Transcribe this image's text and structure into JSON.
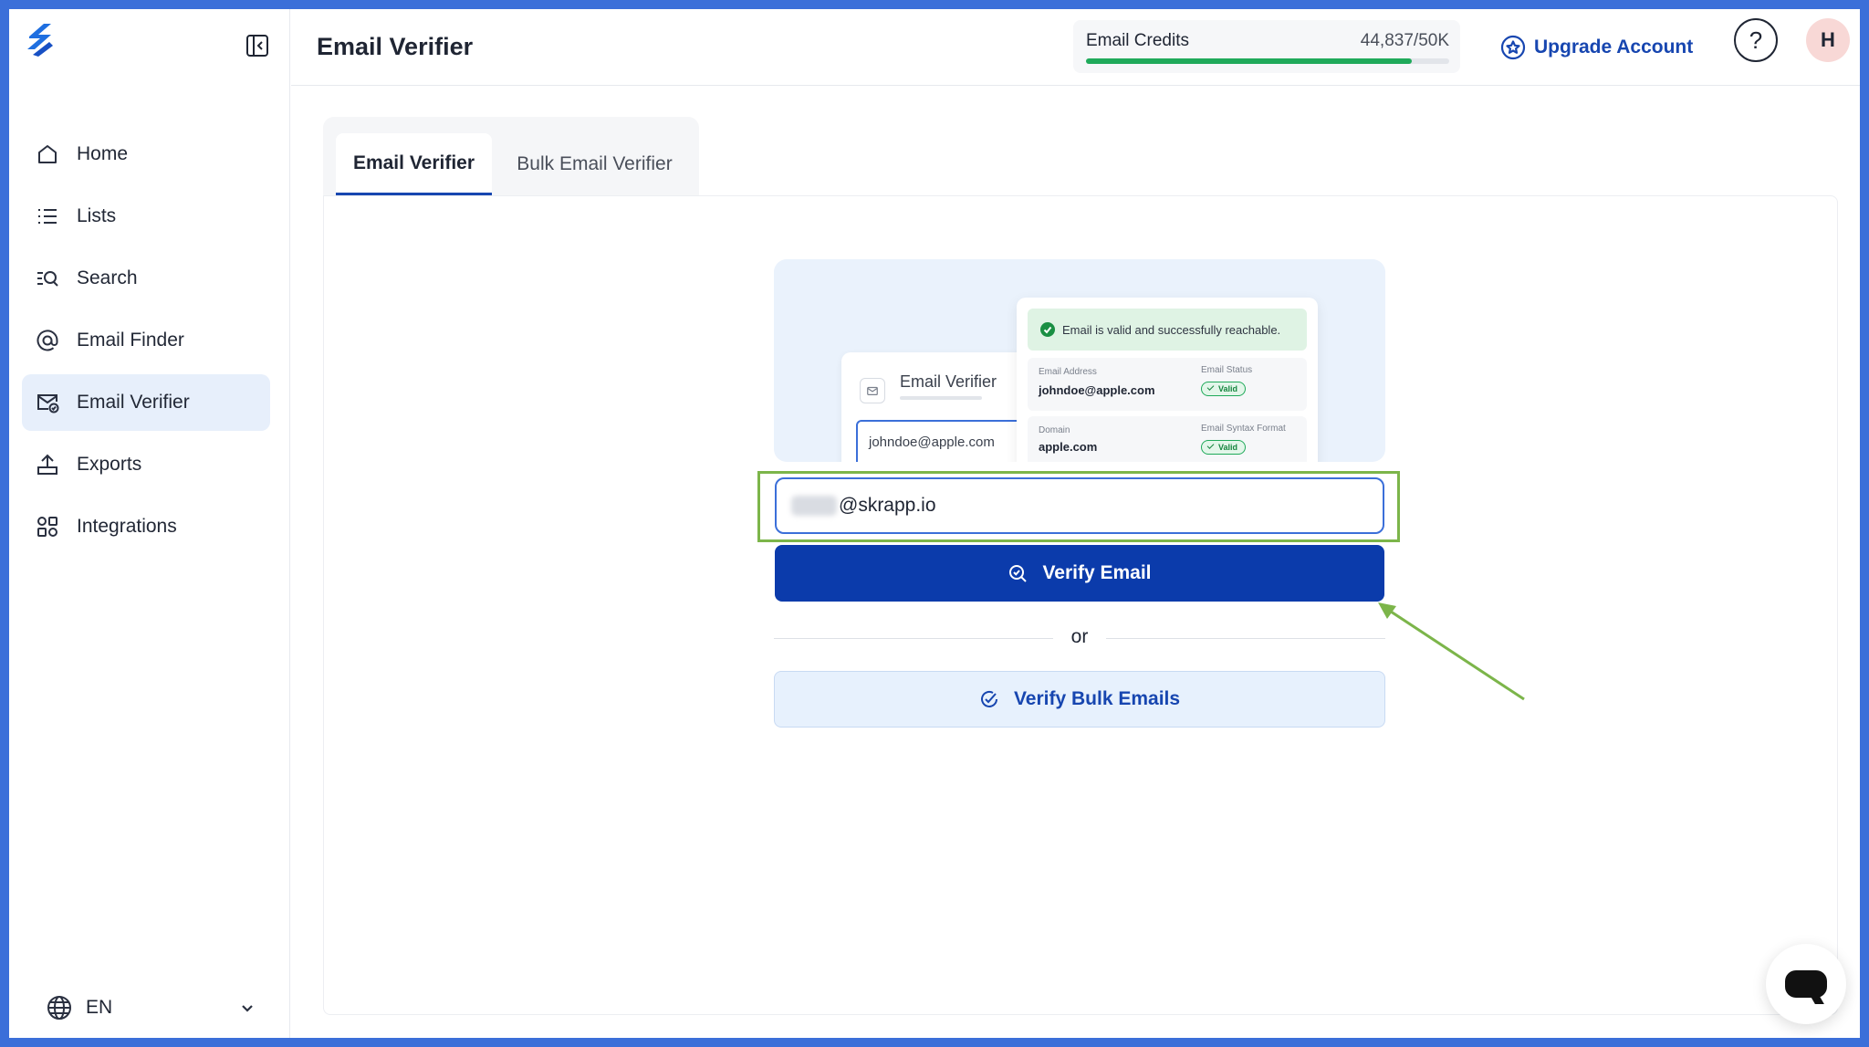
{
  "app": {
    "page_title": "Email Verifier"
  },
  "sidebar": {
    "items": [
      {
        "label": "Home",
        "icon": "home-icon"
      },
      {
        "label": "Lists",
        "icon": "list-icon"
      },
      {
        "label": "Search",
        "icon": "search-icon"
      },
      {
        "label": "Email Finder",
        "icon": "at-icon"
      },
      {
        "label": "Email Verifier",
        "icon": "mail-check-icon",
        "active": true
      },
      {
        "label": "Exports",
        "icon": "export-icon"
      },
      {
        "label": "Integrations",
        "icon": "integrations-icon"
      }
    ],
    "language": "EN"
  },
  "header": {
    "credits_label": "Email Credits",
    "credits_value": "44,837/50K",
    "credits_fraction": 0.897,
    "upgrade_label": "Upgrade Account",
    "help_label": "?",
    "avatar_initial": "H"
  },
  "tabs": [
    {
      "label": "Email Verifier",
      "active": true
    },
    {
      "label": "Bulk Email Verifier",
      "active": false
    }
  ],
  "illustration": {
    "card_title": "Email Verifier",
    "card_input": "johndoe@apple.com",
    "status_message": "Email is valid and successfully reachable.",
    "email_address_label": "Email Address",
    "email_address_value": "johndoe@apple.com",
    "email_status_label": "Email Status",
    "email_status_value": "Valid",
    "domain_label": "Domain",
    "domain_value": "apple.com",
    "syntax_label": "Email Syntax Format",
    "syntax_value": "Valid"
  },
  "form": {
    "email_value": "@skrapp.io",
    "verify_label": "Verify Email",
    "or_label": "or",
    "bulk_label": "Verify Bulk Emails"
  },
  "colors": {
    "accent": "#0b3bab",
    "link": "#1746b0",
    "active_nav_bg": "#e7effb",
    "success": "#1faa5a",
    "annotation": "#7cb54a",
    "frame": "#3b6fd9"
  }
}
